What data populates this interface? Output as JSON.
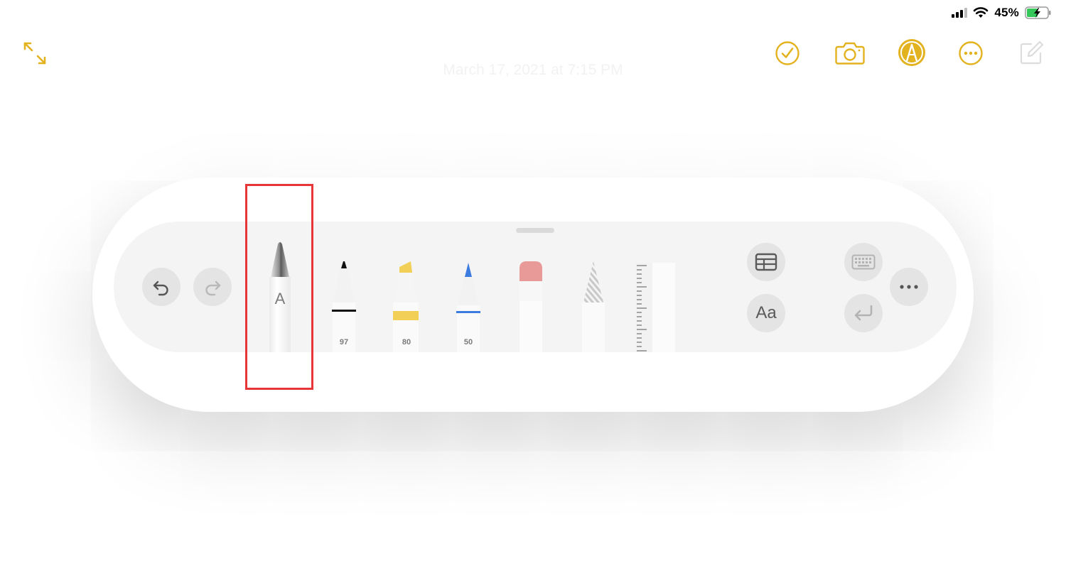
{
  "status_bar": {
    "battery_percent": "45%"
  },
  "note": {
    "date_text": "March 17, 2021 at 7:15 PM"
  },
  "colors": {
    "accent": "#e3b21f",
    "selection": "#e8353a",
    "pen_tip": "#111111",
    "highlighter": "#f2cf57",
    "blue_pen": "#3c7be0",
    "eraser": "#e79a98"
  },
  "top_toolbar": {
    "icons": [
      "expand-icon",
      "checklist-icon",
      "camera-icon",
      "markup-icon",
      "more-icon",
      "compose-icon"
    ]
  },
  "palette": {
    "tools": [
      {
        "name": "handwriting-pencil",
        "label": "A"
      },
      {
        "name": "pen",
        "label": "97"
      },
      {
        "name": "highlighter",
        "label": "80"
      },
      {
        "name": "blue-pen",
        "label": "50"
      },
      {
        "name": "eraser",
        "label": ""
      },
      {
        "name": "lasso",
        "label": ""
      },
      {
        "name": "ruler",
        "label": ""
      }
    ],
    "text_format_label": "Aa"
  }
}
